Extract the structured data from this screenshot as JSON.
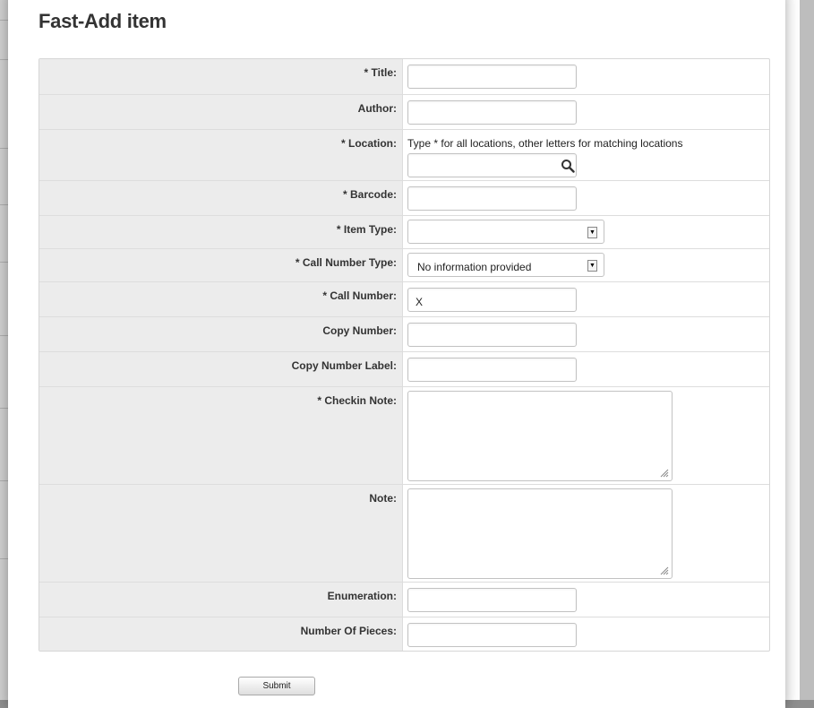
{
  "modal": {
    "title": "Fast-Add item",
    "submit_label": "Submit"
  },
  "fields": {
    "title": {
      "label": "* Title:",
      "value": ""
    },
    "author": {
      "label": "Author:",
      "value": ""
    },
    "location": {
      "label": "* Location:",
      "hint": "Type * for all locations, other letters for matching locations",
      "value": ""
    },
    "barcode": {
      "label": "* Barcode:",
      "value": ""
    },
    "item_type": {
      "label": "* Item Type:",
      "selected": ""
    },
    "call_number_type": {
      "label": "* Call Number Type:",
      "selected": "No information provided"
    },
    "call_number": {
      "label": "* Call Number:",
      "value": "X"
    },
    "copy_number": {
      "label": "Copy Number:",
      "value": ""
    },
    "copy_number_label": {
      "label": "Copy Number Label:",
      "value": ""
    },
    "checkin_note": {
      "label": "* Checkin Note:",
      "value": ""
    },
    "note": {
      "label": "Note:",
      "value": ""
    },
    "enumeration": {
      "label": "Enumeration:",
      "value": ""
    },
    "number_of_pieces": {
      "label": "Number Of Pieces:",
      "value": ""
    }
  },
  "icons": {
    "location_search": "search-icon",
    "select_arrow": "dropdown-arrow-icon",
    "resize": "resize-grip-icon"
  }
}
